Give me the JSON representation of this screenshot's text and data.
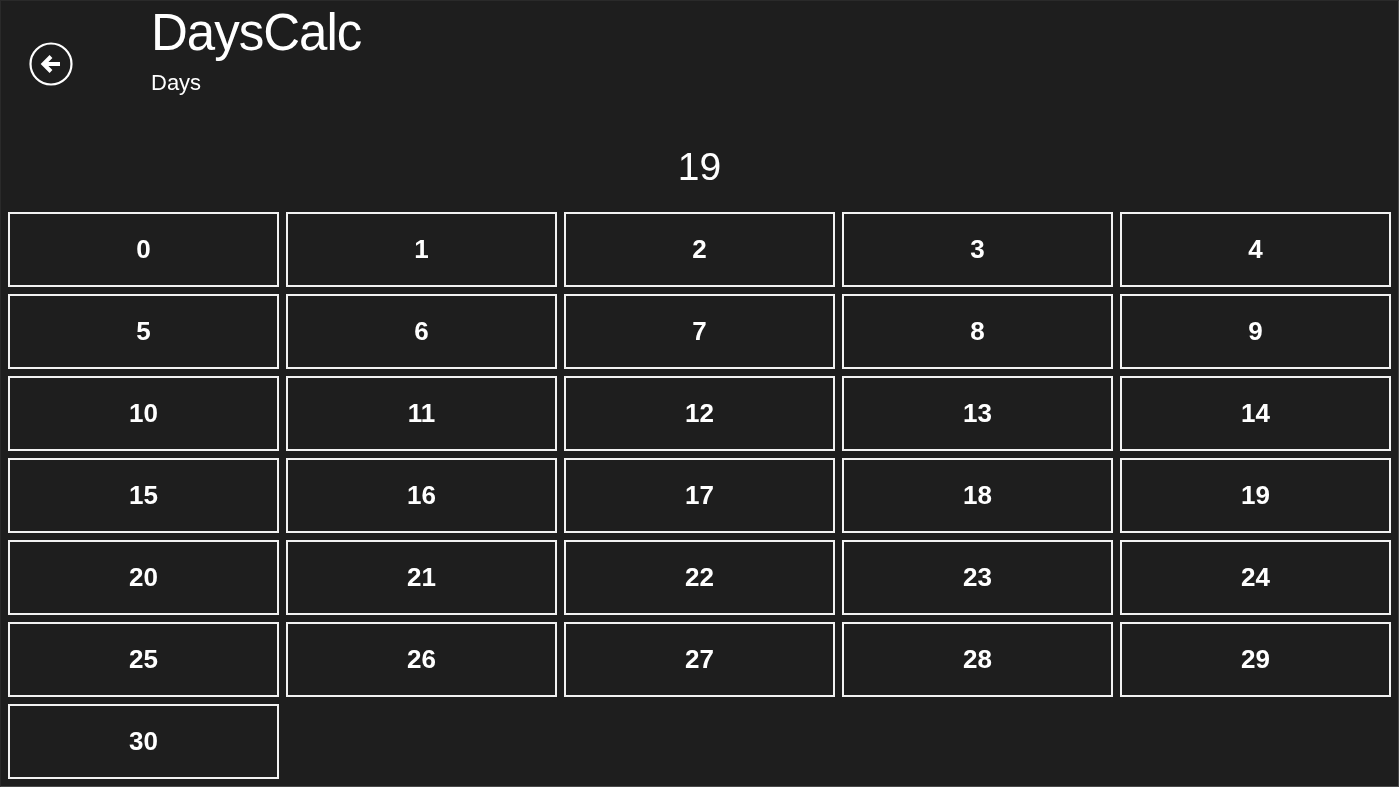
{
  "header": {
    "title": "DaysCalc",
    "subtitle": "Days"
  },
  "result": "19",
  "day_buttons": [
    "0",
    "1",
    "2",
    "3",
    "4",
    "5",
    "6",
    "7",
    "8",
    "9",
    "10",
    "11",
    "12",
    "13",
    "14",
    "15",
    "16",
    "17",
    "18",
    "19",
    "20",
    "21",
    "22",
    "23",
    "24",
    "25",
    "26",
    "27",
    "28",
    "29",
    "30"
  ]
}
